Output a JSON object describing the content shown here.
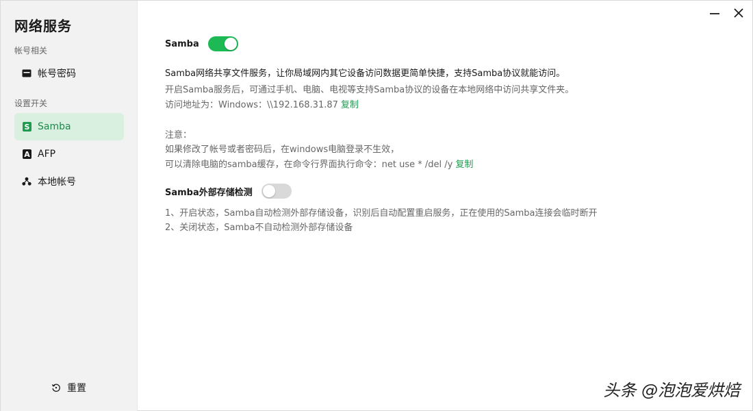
{
  "sidebar": {
    "title": "网络服务",
    "sections": {
      "account": "帐号相关",
      "settings": "设置开关"
    },
    "items": [
      {
        "label": "帐号密码",
        "icon": "card-icon"
      },
      {
        "label": "Samba",
        "icon": "samba-icon",
        "glyph": "S"
      },
      {
        "label": "AFP",
        "icon": "afp-icon",
        "glyph": "A"
      },
      {
        "label": "本地帐号",
        "icon": "users-icon"
      }
    ],
    "reset_label": "重置"
  },
  "window": {
    "minimize_icon": "minimize-icon",
    "close_icon": "close-icon"
  },
  "samba": {
    "title": "Samba",
    "enabled": true,
    "desc_main": "Samba网络共享文件服务，让你局域网内其它设备访问数据更简单快捷，支持Samba协议就能访问。",
    "desc_sub": "开启Samba服务后，可通过手机、电脑、电视等支持Samba协议的设备在本地网络中访问共享文件夹。",
    "address_line": "访问地址为：Windows：\\\\192.168.31.87",
    "copy_label": "复制",
    "note_title": "注意：",
    "note_line1": "如果修改了帐号或者密码后，在windows电脑登录不生效，",
    "note_line2": "可以清除电脑的samba缓存，在命令行界面执行命令：net use * /del /y",
    "copy_label_2": "复制"
  },
  "external": {
    "title": "Samba外部存储检测",
    "enabled": false,
    "line1": "1、开启状态，Samba自动检测外部存储设备，识别后自动配置重启服务，正在使用的Samba连接会临时断开",
    "line2": "2、关闭状态，Samba不自动检测外部存储设备"
  },
  "watermark": "头条 @泡泡爱烘焙",
  "colors": {
    "accent": "#1db954",
    "link": "#1f9a50",
    "active_bg": "#d9efe0",
    "sidebar_bg": "#f2f2f2"
  }
}
